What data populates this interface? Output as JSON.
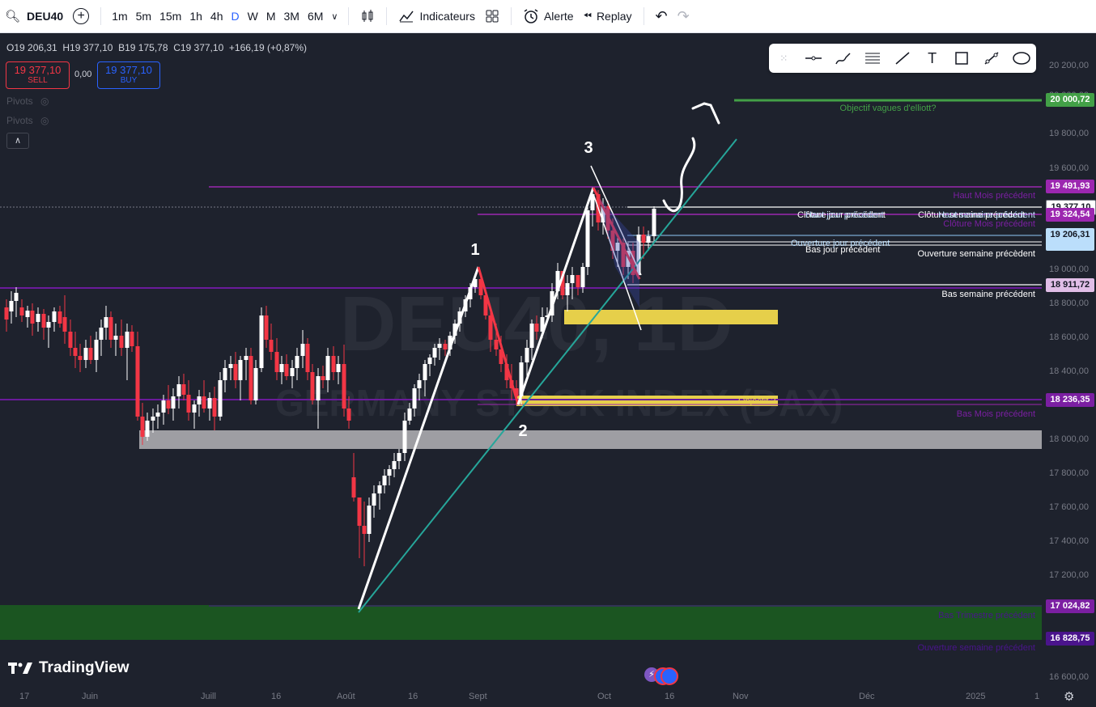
{
  "toolbar": {
    "symbol": "DEU40",
    "intervals": [
      "1m",
      "5m",
      "15m",
      "1h",
      "4h",
      "D",
      "W",
      "M",
      "3M",
      "6M"
    ],
    "active_interval": "D",
    "indicators_label": "Indicateurs",
    "alert_label": "Alerte",
    "replay_label": "Replay"
  },
  "ohlc": {
    "open": "O19 206,31",
    "high": "H19 377,10",
    "low": "B19 175,78",
    "close": "C19 377,10",
    "change": "+166,19 (+0,87%)"
  },
  "trade": {
    "sell_price": "19 377,10",
    "sell_label": "SELL",
    "spread": "0,00",
    "buy_price": "19 377,10",
    "buy_label": "BUY"
  },
  "pivots": [
    "Pivots",
    "Pivots"
  ],
  "watermark": {
    "symbol": "DEU40, 1D",
    "name": "GERMANY STOCK INDEX (DAX)"
  },
  "price_axis": [
    "20 200,00",
    "20 000,00",
    "19 800,00",
    "19 600,00",
    "19 000,00",
    "18 800,00",
    "18 600,00",
    "18 400,00",
    "18 000,00",
    "17 800,00",
    "17 600,00",
    "17 400,00",
    "17 200,00",
    "16 600,00"
  ],
  "price_tags": {
    "target": "20 000,72",
    "haut_mois": "19 491,93",
    "current": "19 377,10",
    "cloture_semaine": "19 324,54",
    "open": "19 206,31",
    "bas_semaine": "18 911,72",
    "objectif2": "18 236,35",
    "bas_trimestre": "17 024,82",
    "low": "16 828,75"
  },
  "time_axis": [
    "17",
    "Juin",
    "Juill",
    "16",
    "Août",
    "16",
    "Sept",
    "Oct",
    "16",
    "Nov",
    "Déc",
    "2025",
    "1"
  ],
  "labels": {
    "objectif_elliott": "Objectif vagues d'elliott?",
    "haut_mois": "Haut Mois précédent",
    "haut_jour": "Haut jour précédent",
    "cloture_jour": "Clôture jour précédent",
    "cloture_semaine": "Clôture semaine précédent",
    "haut_semaine": "Haut semaine précédent",
    "cloture_mois": "Clôture Mois précédent",
    "ouverture_jour": "Ouverture jour précédent",
    "bas_jour": "Bas jour précédent",
    "ouverture_semaine": "Ouverture semaine  précèdent",
    "bas_semaine": "Bas semaine précédent",
    "objectif2": "Objectif 2",
    "bas_mois": "Bas Mois précédent",
    "bas_trimestre": "Bas Trimestre précédent",
    "ouverture_semaine2": "Ouverture semaine précédent"
  },
  "waves": [
    "1",
    "2",
    "3"
  ],
  "logo": "TradingView",
  "colors": {
    "background": "#1e222d",
    "up": "#ffffff",
    "down": "#f23645",
    "accent": "#2962ff",
    "purple": "#9c27b0",
    "target_green": "#43a047",
    "zone_yellow": "#e6cf4a",
    "zone_gray": "#9e9ea3",
    "trend": "#26a69a"
  }
}
